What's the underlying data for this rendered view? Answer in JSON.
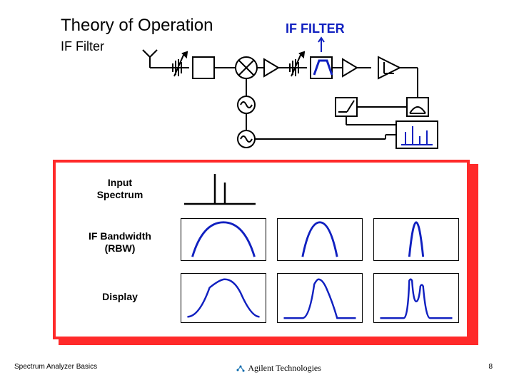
{
  "title": "Theory of Operation",
  "subtitle": "IF Filter",
  "highlight_label": "IF FILTER",
  "panel": {
    "rows": [
      {
        "label": "Input\nSpectrum"
      },
      {
        "label": "IF Bandwidth\n(RBW)"
      },
      {
        "label": "Display"
      }
    ]
  },
  "footer": {
    "left": "Spectrum Analyzer Basics",
    "brand": "Agilent Technologies",
    "page": "8"
  },
  "diagram": {
    "signal_chain": [
      "antenna",
      "attenuator",
      "lpf-block",
      "mixer",
      "amplifier",
      "attenuator",
      "if-filter",
      "amplifier",
      "log-amp",
      "envelope-detector",
      "video-filter",
      "display"
    ],
    "oscillators": [
      "lo",
      "sweep-gen"
    ]
  }
}
